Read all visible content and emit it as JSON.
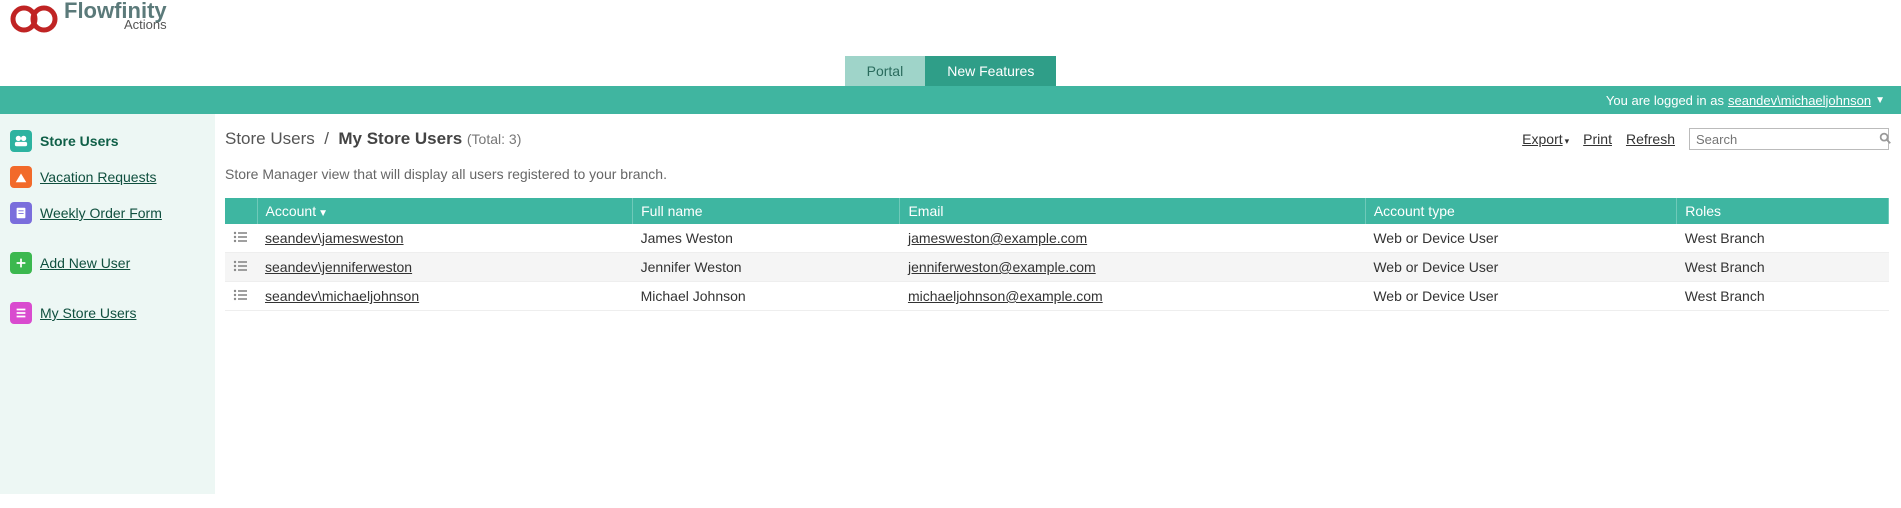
{
  "brand": {
    "name": "Flowfinity",
    "subtitle": "Actions"
  },
  "tabs": {
    "portal": "Portal",
    "new_features": "New Features"
  },
  "login_bar": {
    "prefix": "You are logged in as",
    "user": "seandev\\michaeljohnson"
  },
  "sidebar": {
    "items": [
      {
        "label": "Store Users"
      },
      {
        "label": "Vacation Requests"
      },
      {
        "label": "Weekly Order Form"
      }
    ],
    "add_new_user": "Add New User",
    "my_store_users": "My Store Users"
  },
  "breadcrumb": {
    "root": "Store Users",
    "current": "My Store Users",
    "total": "(Total: 3)"
  },
  "actions": {
    "export": "Export",
    "print": "Print",
    "refresh": "Refresh"
  },
  "search": {
    "placeholder": "Search"
  },
  "description": "Store Manager view that will display all users registered to your branch.",
  "columns": {
    "account": "Account",
    "full_name": "Full name",
    "email": "Email",
    "account_type": "Account type",
    "roles": "Roles"
  },
  "rows": [
    {
      "account": "seandev\\jamesweston",
      "full_name": "James Weston",
      "email": "jamesweston@example.com",
      "account_type": "Web or Device User",
      "roles": "West Branch"
    },
    {
      "account": "seandev\\jenniferweston",
      "full_name": "Jennifer Weston",
      "email": "jenniferweston@example.com",
      "account_type": "Web or Device User",
      "roles": "West Branch"
    },
    {
      "account": "seandev\\michaeljohnson",
      "full_name": "Michael Johnson",
      "email": "michaeljohnson@example.com",
      "account_type": "Web or Device User",
      "roles": "West Branch"
    }
  ]
}
